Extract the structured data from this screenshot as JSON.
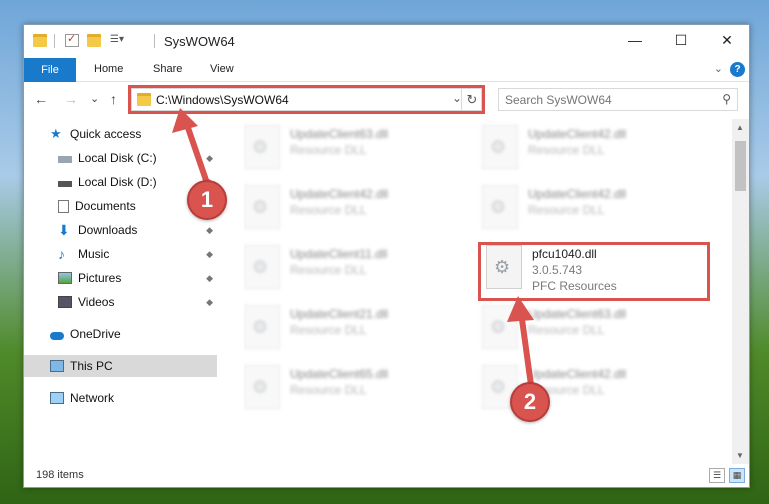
{
  "window": {
    "title": "SysWOW64",
    "minimize_glyph": "—",
    "maximize_glyph": "☐",
    "close_glyph": "✕"
  },
  "ribbon": {
    "tabs": [
      "File",
      "Home",
      "Share",
      "View"
    ],
    "collapse_glyph": "⌄",
    "help_glyph": "?"
  },
  "toolbar": {
    "back_glyph": "←",
    "forward_glyph": "→",
    "recent_glyph": "⌄",
    "up_glyph": "↑",
    "address_path": "C:\\Windows\\SysWOW64",
    "address_dropdown_glyph": "⌄",
    "refresh_glyph": "↻",
    "search_placeholder": "Search SysWOW64",
    "search_glyph": "⚲"
  },
  "sidebar": {
    "items": [
      {
        "label": "Quick access",
        "icon": "star-icon",
        "pinned": false
      },
      {
        "label": "Local Disk (C:)",
        "icon": "drive-icon",
        "pinned": true
      },
      {
        "label": "Local Disk (D:)",
        "icon": "drive-icon",
        "pinned": true
      },
      {
        "label": "Documents",
        "icon": "documents-icon",
        "pinned": true
      },
      {
        "label": "Downloads",
        "icon": "downloads-icon",
        "pinned": true
      },
      {
        "label": "Music",
        "icon": "music-icon",
        "pinned": true
      },
      {
        "label": "Pictures",
        "icon": "pictures-icon",
        "pinned": true
      },
      {
        "label": "Videos",
        "icon": "videos-icon",
        "pinned": true
      },
      {
        "label": "OneDrive",
        "icon": "cloud-icon",
        "pinned": false
      },
      {
        "label": "This PC",
        "icon": "computer-icon",
        "pinned": false
      },
      {
        "label": "Network",
        "icon": "network-icon",
        "pinned": false
      }
    ],
    "pin_glyph": "📌"
  },
  "files": {
    "left": [
      {
        "name": "UpdateClient63.dll",
        "desc": "Resource DLL"
      },
      {
        "name": "UpdateClient42.dll",
        "desc": "Resource DLL"
      },
      {
        "name": "UpdateClient11.dll",
        "desc": "Resource DLL"
      },
      {
        "name": "UpdateClient21.dll",
        "desc": "Resource DLL"
      },
      {
        "name": "UpdateClient65.dll",
        "desc": "Resource DLL"
      }
    ],
    "right": [
      {
        "name": "UpdateClient42.dll",
        "desc": "Resource DLL"
      },
      {
        "name": "UpdateClient42.dll",
        "desc": "Resource DLL"
      },
      {
        "name": "UpdateClient63.dll",
        "desc": "Resource DLL"
      },
      {
        "name": "UpdateClient42.dll",
        "desc": "Resource DLL"
      }
    ],
    "highlighted": {
      "name": "pfcu1040.dll",
      "version": "3.0.5.743",
      "company": "PFC Resources"
    }
  },
  "status": {
    "item_count": "198 items"
  },
  "callouts": {
    "one": "1",
    "two": "2"
  },
  "colors": {
    "accent": "#1979ca",
    "callout": "#d9534f"
  }
}
